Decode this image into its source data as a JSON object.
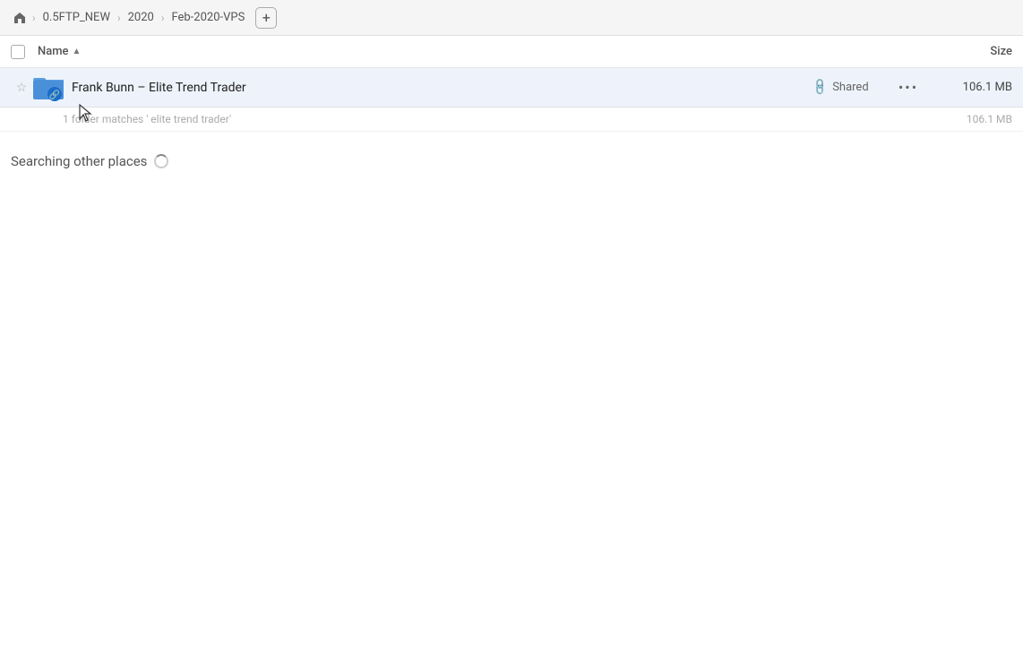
{
  "toolbar": {
    "home_label": "home",
    "breadcrumbs": [
      {
        "label": "0.5FTP_NEW"
      },
      {
        "label": "2020"
      },
      {
        "label": "Feb-2020-VPS"
      }
    ],
    "add_button_label": "+"
  },
  "columns": {
    "name_label": "Name",
    "sort_indicator": "▲",
    "size_label": "Size"
  },
  "file_row": {
    "name": "Frank Bunn – Elite Trend Trader",
    "shared_label": "Shared",
    "size": "106.1 MB",
    "more_icon": "•••"
  },
  "match_info": {
    "text": "1 folder matches ' elite trend trader'",
    "size": "106.1 MB"
  },
  "searching_section": {
    "label": "Searching other places"
  }
}
